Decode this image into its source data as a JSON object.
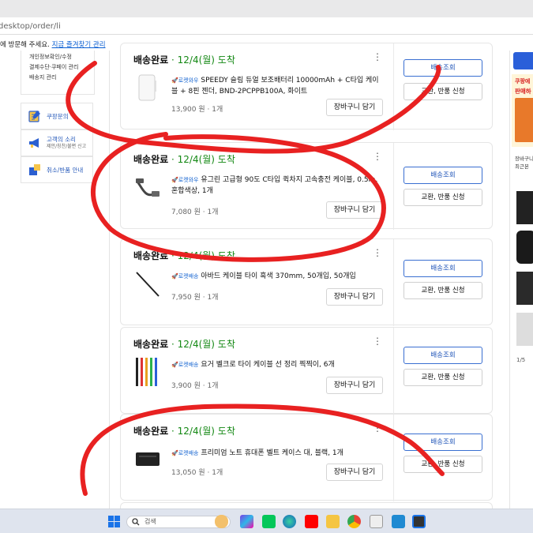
{
  "browser": {
    "url": "desktop/order/li",
    "notice_text": "에 방문해 주세요.",
    "notice_link": "지금 즐겨찾기 관리"
  },
  "left_menu": {
    "items": [
      "개인정보확인/수정",
      "결제수단·쿠페이 관리",
      "배송지 관리"
    ],
    "links": [
      {
        "label": "쿠팡문의",
        "sub": "",
        "icon": "inquiry-icon"
      },
      {
        "label": "고객의 소리",
        "sub": "제안/칭찬/불편 신고",
        "icon": "megaphone-icon"
      },
      {
        "label": "취소/반품 안내",
        "sub": "",
        "icon": "box-icon"
      }
    ]
  },
  "orders": [
    {
      "status": "배송완료",
      "date": "· 12/4(월) 도착",
      "badge": "로켓와우",
      "name": "SPEEDY 슬림 듀얼 보조배터리 10000mAh + C타입 케이블 + 8핀 젠더, BND-2PCPPB100A, 화이트",
      "price": "13,900 원 · 1개",
      "thumb_icon": "power-bank-icon"
    },
    {
      "status": "배송완료",
      "date": "· 12/4(월) 도착",
      "badge": "로켓와우",
      "name": "유그린 고급형 90도 C타입 퀵차지 고속충전 케이블, 0.5m, 혼합색상, 1개",
      "price": "7,080 원 · 1개",
      "thumb_icon": "usb-cable-icon"
    },
    {
      "status": "배송완료",
      "date": "· 12/4(월) 도착",
      "badge": "로켓배송",
      "name": "아바드 케이블 타이 흑색 370mm, 50개입, 50개입",
      "price": "7,950 원 · 1개",
      "thumb_icon": "cable-tie-icon"
    },
    {
      "status": "배송완료",
      "date": "· 12/4(월) 도착",
      "badge": "로켓배송",
      "name": "요거 벨크로 타이 케이블 선 정리 찍찍이, 6개",
      "price": "3,900 원 · 1개",
      "thumb_icon": "velcro-tie-icon"
    },
    {
      "status": "배송완료",
      "date": "· 12/4(월) 도착",
      "badge": "로켓배송",
      "name": "프리미엄 노트 휴대폰 벨트 케이스 대, 블랙, 1개",
      "price": "13,050 원 · 1개",
      "thumb_icon": "belt-case-icon"
    }
  ],
  "buttons": {
    "cart": "장바구니 담기",
    "track": "배송조회",
    "return": "교환, 반품 신청"
  },
  "right_rail": {
    "ad_line1": "쿠팡에",
    "ad_line2": "판매하",
    "heading": "장바구니",
    "heading2": "최근본",
    "pager": "1/5"
  },
  "taskbar": {
    "search_placeholder": "검색"
  },
  "colors": {
    "delivered_date": "#138813",
    "link_blue": "#2357b9",
    "marker_red": "#e82121"
  }
}
